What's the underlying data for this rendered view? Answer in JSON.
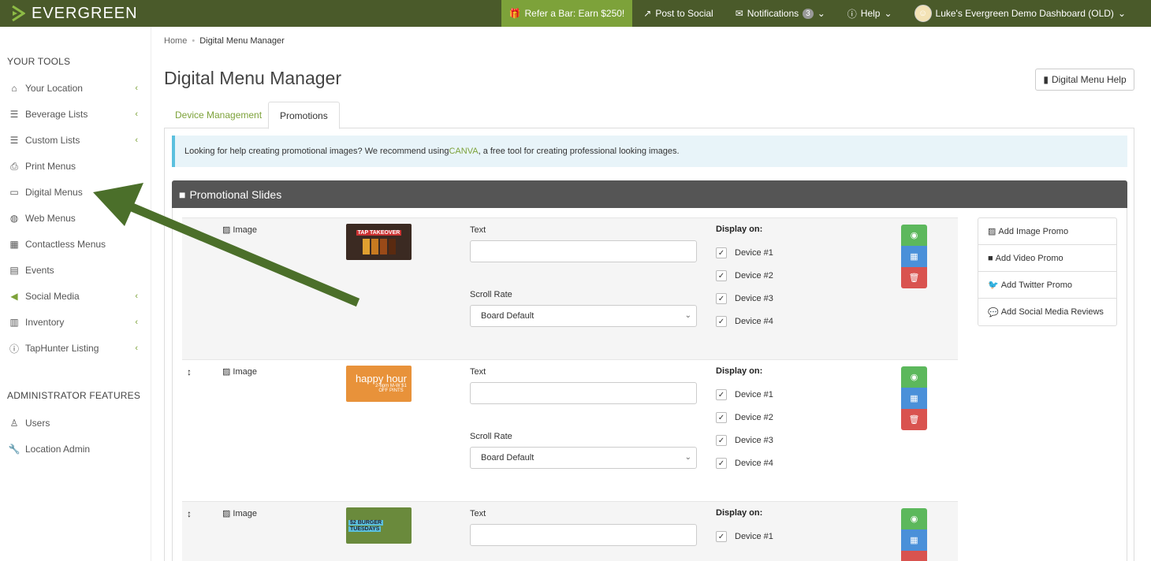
{
  "topbar": {
    "logo_text": "EVERGREEN",
    "refer": "Refer a Bar: Earn $250!",
    "post_social": "Post to Social",
    "notifications": "Notifications",
    "notification_count": "3",
    "help": "Help",
    "account": "Luke's Evergreen Demo Dashboard (OLD)"
  },
  "sidebar": {
    "tools_heading": "YOUR TOOLS",
    "items": [
      {
        "label": "Your Location",
        "icon": "home-icon"
      },
      {
        "label": "Beverage Lists",
        "icon": "list-icon"
      },
      {
        "label": "Custom Lists",
        "icon": "list-icon"
      },
      {
        "label": "Print Menus",
        "icon": "printer-icon"
      },
      {
        "label": "Digital Menus",
        "icon": "monitor-icon"
      },
      {
        "label": "Web Menus",
        "icon": "globe-icon"
      },
      {
        "label": "Contactless Menus",
        "icon": "qr-icon"
      },
      {
        "label": "Events",
        "icon": "calendar-icon"
      },
      {
        "label": "Social Media",
        "icon": "megaphone-icon"
      },
      {
        "label": "Inventory",
        "icon": "bar-chart-icon"
      },
      {
        "label": "TapHunter Listing",
        "icon": "info-icon"
      }
    ],
    "admin_heading": "ADMINISTRATOR FEATURES",
    "admin_items": [
      {
        "label": "Users",
        "icon": "user-icon"
      },
      {
        "label": "Location Admin",
        "icon": "wrench-icon"
      }
    ]
  },
  "breadcrumb": {
    "home": "Home",
    "current": "Digital Menu Manager"
  },
  "page_title": "Digital Menu Manager",
  "help_button": "Digital Menu Help",
  "tabs": [
    {
      "label": "Device Management"
    },
    {
      "label": "Promotions"
    }
  ],
  "info": {
    "before": "Looking for help creating promotional images? We recommend using ",
    "link": "CANVA",
    "after": ", a free tool for creating professional looking images."
  },
  "panel_title": "Promotional Slides",
  "field_labels": {
    "text": "Text",
    "scroll_rate": "Scroll Rate",
    "display_on": "Display on:",
    "type_image": "Image"
  },
  "scroll_rate_value": "Board Default",
  "devices": [
    "Device #1",
    "Device #2",
    "Device #3",
    "Device #4"
  ],
  "slides": [
    {
      "thumb_line1": "TAP TAKEOVER",
      "thumb_line2": "",
      "thumb_bg": "#3b2a22"
    },
    {
      "thumb_line1": "happy hour",
      "thumb_line2": "2-6pm M-W $1 OFF PINTS",
      "thumb_bg": "#e8923a"
    },
    {
      "thumb_line1": "$2 BURGER",
      "thumb_line2": "TUESDAYS",
      "thumb_bg": "#6a8a3c"
    }
  ],
  "add_menu": [
    {
      "label": "Add Image Promo",
      "icon": "image-icon"
    },
    {
      "label": "Add Video Promo",
      "icon": "video-icon"
    },
    {
      "label": "Add Twitter Promo",
      "icon": "twitter-icon"
    },
    {
      "label": "Add Social Media Reviews",
      "icon": "comment-icon"
    }
  ],
  "colors": {
    "accent": "#7da23a",
    "topbar": "#4a5a2a",
    "panel_header": "#555555",
    "arrow": "#4b6f2a"
  }
}
